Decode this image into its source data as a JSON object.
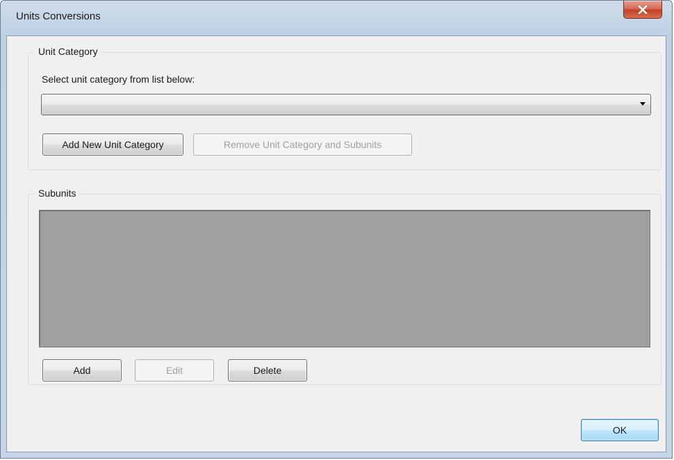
{
  "window": {
    "title": "Units Conversions",
    "close_glyph": "X"
  },
  "unit_category": {
    "group_label": "Unit Category",
    "prompt_label": "Select unit category from list below:",
    "combo": {
      "selected_value": ""
    },
    "add_button_label": "Add New Unit Category",
    "remove_button_label": "Remove Unit Category and Subunits"
  },
  "subunits": {
    "group_label": "Subunits",
    "list_items": [],
    "add_button_label": "Add",
    "edit_button_label": "Edit",
    "delete_button_label": "Delete"
  },
  "footer": {
    "ok_button_label": "OK"
  },
  "colors": {
    "dialog_background": "#f0f0f0",
    "listview_background": "#a0a0a0",
    "close_button_red": "#c0412b",
    "default_button_blue": "#3c7fb1"
  },
  "icons": {
    "close": "close-icon",
    "dropdown": "chevron-down-icon"
  }
}
